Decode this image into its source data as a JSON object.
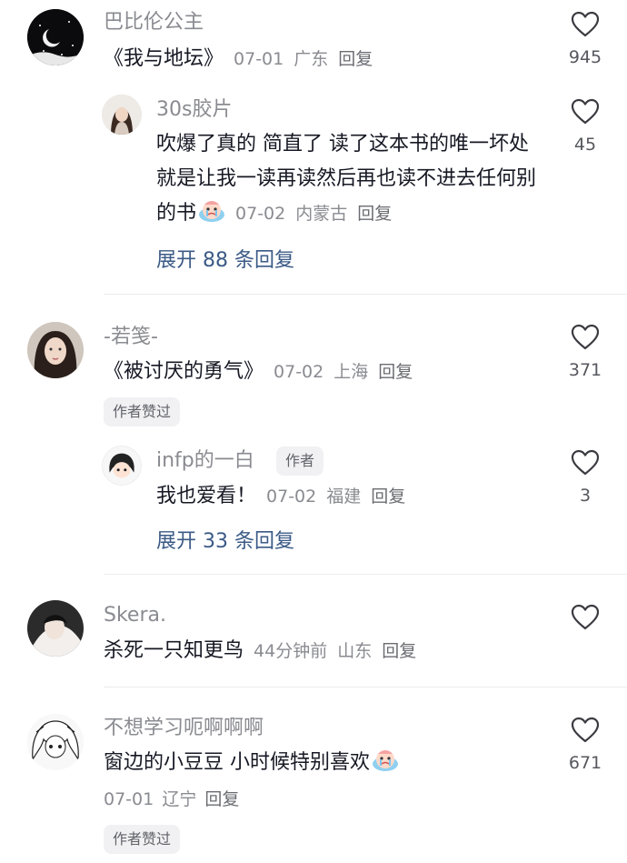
{
  "comments": [
    {
      "user": "巴比伦公主",
      "text": "《我与地坛》",
      "date": "07-01",
      "location": "广东",
      "reply_label": "回复",
      "likes": "945",
      "replies": [
        {
          "user": "30s胶片",
          "text": "吹爆了真的 简直了 读了这本书的唯一坏处就是让我一读再读然后再也读不进去任何别的书",
          "emoji": "crying-face-emoji",
          "date": "07-02",
          "location": "内蒙古",
          "reply_label": "回复",
          "likes": "45"
        }
      ],
      "expand_label": "展开 88 条回复"
    },
    {
      "user": "-若笺-",
      "text": "《被讨厌的勇气》",
      "date": "07-02",
      "location": "上海",
      "reply_label": "回复",
      "likes": "371",
      "badge": "作者赞过",
      "replies": [
        {
          "user": "infp的一白",
          "author_tag": "作者",
          "text": "我也爱看！",
          "date": "07-02",
          "location": "福建",
          "reply_label": "回复",
          "likes": "3"
        }
      ],
      "expand_label": "展开 33 条回复"
    },
    {
      "user": "Skera.",
      "text": "杀死一只知更鸟",
      "date": "44分钟前",
      "location": "山东",
      "reply_label": "回复",
      "likes": ""
    },
    {
      "user": "不想学习呃啊啊啊",
      "text": "窗边的小豆豆 小时候特别喜欢",
      "emoji": "crying-face-emoji",
      "date": "07-01",
      "location": "辽宁",
      "reply_label": "回复",
      "likes": "671",
      "badge": "作者赞过"
    }
  ],
  "colors": {
    "text": "#161823",
    "muted": "#8a8b91",
    "link": "#3b5a86",
    "badge_bg": "#f1f1f3"
  }
}
